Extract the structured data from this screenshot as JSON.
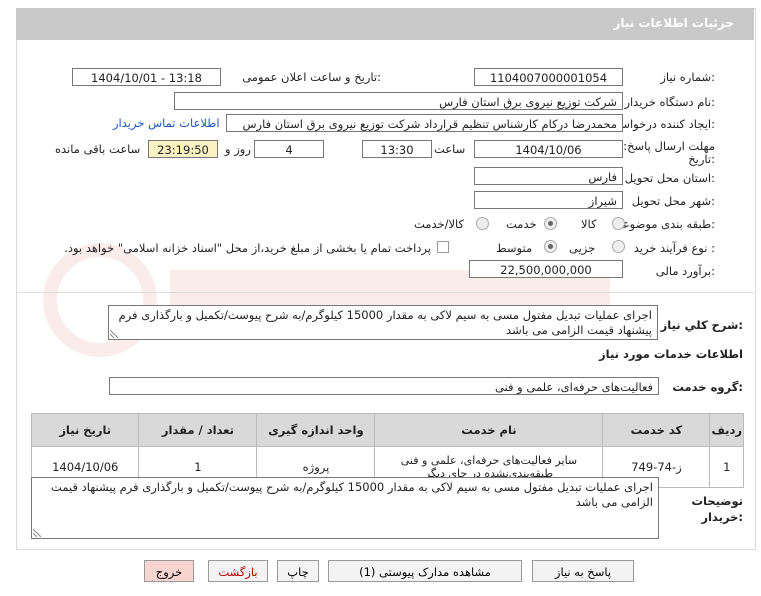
{
  "header": {
    "title": "جزئیات اطلاعات نیاز"
  },
  "fields": {
    "need_number_label": "شماره نیاز:",
    "need_number": "1104007000001054",
    "announce_label": "تاریخ و ساعت اعلان عمومی:",
    "announce_value": "1404/10/01 - 13:18",
    "buyer_label": "نام دستگاه خریدار:",
    "buyer_value": "شرکت توزیع نیروی برق استان فارس",
    "creator_label": "ایجاد کننده درخواست:",
    "creator_value": "محمدرضا درکام کارشناس تنظیم قرارداد شرکت توزیع نیروی برق استان فارس",
    "contact_link": "اطلاعات تماس خریدار",
    "deadline_label_1": "مهلت ارسال پاسخ: تا",
    "deadline_label_2": "تاریخ:",
    "deadline_date": "1404/10/06",
    "time_label": "ساعت",
    "deadline_time": "13:30",
    "days_value": "4",
    "days_label": "روز و",
    "remaining_value": "23:19:50",
    "remaining_label": "ساعت باقی مانده",
    "province_label": "استان محل تحویل:",
    "province_value": "فارس",
    "city_label": "شهر محل تحویل:",
    "city_value": "شیراز",
    "category_label": "طبقه بندی موضوعی:",
    "cat_goods": "کالا",
    "cat_service": "خدمت",
    "cat_goods_service": "کالا/خدمت",
    "process_label": "نوع فرآیند خرید :",
    "proc_partial": "جزیی",
    "proc_medium": "متوسط",
    "payment_note": "پرداخت تمام یا بخشی از مبلغ خرید،از محل \"اسناد خزانه اسلامی\" خواهد بود.",
    "estimate_label": "برآورد مالی:",
    "estimate_value": "22,500,000,000"
  },
  "general": {
    "label": "شرح کلي نياز:",
    "text": "اجرای عملیات تبدیل مفتول مسی به سیم لاکی به مقدار 15000 کیلوگرم/به شرح پیوست/تکمیل و بارگذاری فرم پیشنهاد قیمت الزامی می باشد"
  },
  "services": {
    "section_title": "اطلاعات خدمات مورد نیاز",
    "group_label": "گروه خدمت:",
    "group_value": "فعالیت‌های حرفه‌ای، علمی و فنی",
    "headers": [
      "ردیف",
      "کد خدمت",
      "نام خدمت",
      "واحد اندازه گیری",
      "تعداد / مقدار",
      "تاریخ نیاز"
    ],
    "rows": [
      [
        "1",
        "ز-74-749",
        "سایر فعالیت‌های حرفه‌ای، علمی و فنی طبقه‌بندی‌نشده در جای دیگر",
        "پروژه",
        "1",
        "1404/10/06"
      ]
    ]
  },
  "buyer_notes": {
    "label_1": "توضیحات",
    "label_2": "خریدار:",
    "text": "اجرای عملیات تبدیل مفتول مسی به سیم لاکی به مقدار 15000 کیلوگرم/به شرح پیوست/تکمیل و بارگذاری فرم پیشنهاد قیمت الزامی می باشد"
  },
  "buttons": {
    "reply": "پاسخ به نیاز",
    "attachments": "مشاهده مدارک پیوستی (1)",
    "print": "چاپ",
    "back": "بازگشت",
    "exit": "خروج"
  },
  "colors": {
    "header_bg": "#c9c9c9",
    "yellow_box": "#fbf2c4",
    "link": "#1a56c4",
    "exit_btn": "#f6d5d0"
  }
}
